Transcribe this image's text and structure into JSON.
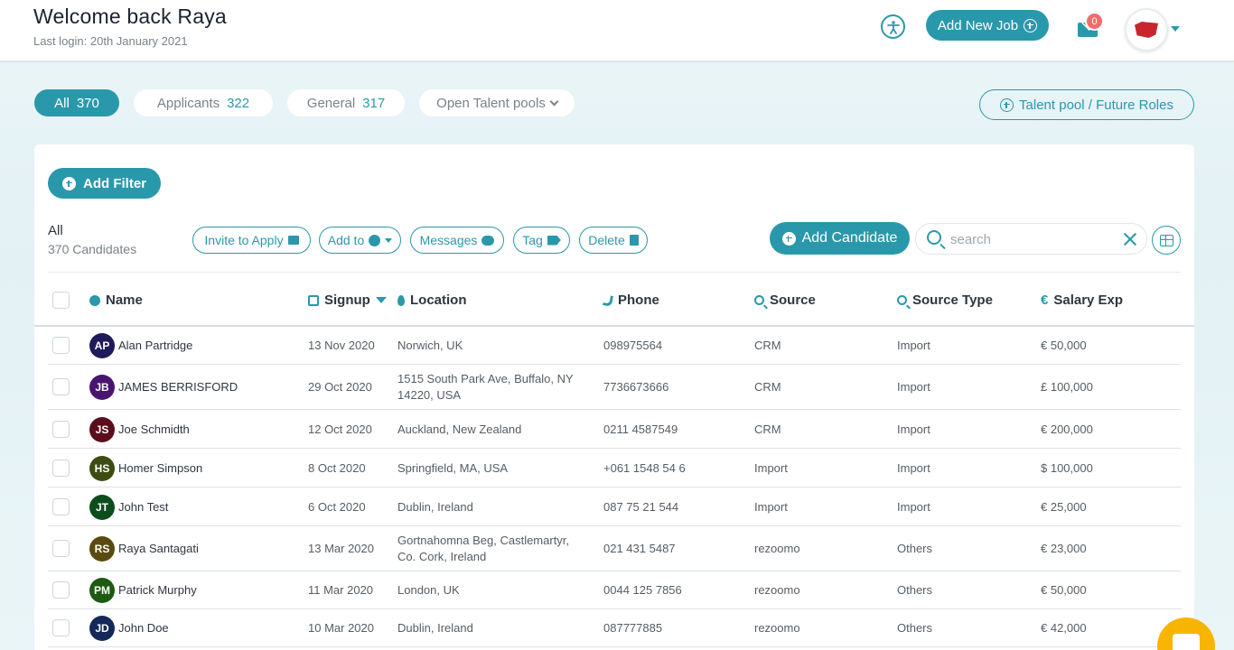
{
  "header": {
    "welcome": "Welcome back Raya",
    "last_login": "Last login: 20th January 2021",
    "add_job_label": "Add New Job",
    "mail_badge": "0"
  },
  "tabs": [
    {
      "label": "All",
      "count": "370",
      "active": true
    },
    {
      "label": "Applicants",
      "count": "322"
    },
    {
      "label": "General",
      "count": "317"
    },
    {
      "label": "Open Talent pools"
    }
  ],
  "talent_pool_label": "Talent pool / Future Roles",
  "toolbar": {
    "add_filter": "Add Filter",
    "selection_title": "All",
    "selection_count": "370 Candidates",
    "invite": "Invite to Apply",
    "add_to": "Add to",
    "messages": "Messages",
    "tag": "Tag",
    "delete": "Delete",
    "add_candidate": "Add Candidate",
    "search_placeholder": "search"
  },
  "columns": {
    "name": "Name",
    "signup": "Signup",
    "location": "Location",
    "phone": "Phone",
    "source": "Source",
    "source_type": "Source Type",
    "salary": "Salary Exp"
  },
  "rows": [
    {
      "initials": "AP",
      "color": "#1f1a5c",
      "name": "Alan Partridge",
      "signup": "13 Nov 2020",
      "location": "Norwich, UK",
      "phone": "098975564",
      "source": "CRM",
      "source_type": "Import",
      "salary": "€ 50,000"
    },
    {
      "initials": "JB",
      "color": "#4a1570",
      "name": "JAMES BERRISFORD",
      "signup": "29 Oct 2020",
      "location": "1515 South Park Ave, Buffalo, NY 14220, USA",
      "phone": "7736673666",
      "source": "CRM",
      "source_type": "Import",
      "salary": "£ 100,000"
    },
    {
      "initials": "JS",
      "color": "#5a0e1c",
      "name": "Joe Schmidth",
      "signup": "12 Oct 2020",
      "location": "Auckland, New Zealand",
      "phone": "0211 4587549",
      "source": "CRM",
      "source_type": "Import",
      "salary": "€ 200,000"
    },
    {
      "initials": "HS",
      "color": "#3d4d12",
      "name": "Homer Simpson",
      "signup": "8 Oct 2020",
      "location": "Springfield, MA, USA",
      "phone": "+061 1548 54 6",
      "source": "Import",
      "source_type": "Import",
      "salary": "$ 100,000"
    },
    {
      "initials": "JT",
      "color": "#0d4d1c",
      "name": "John Test",
      "signup": "6 Oct 2020",
      "location": "Dublin, Ireland",
      "phone": "087 75 21 544",
      "source": "Import",
      "source_type": "Import",
      "salary": "€ 25,000"
    },
    {
      "initials": "RS",
      "color": "#5a4a10",
      "name": "Raya Santagati",
      "signup": "13 Mar 2020",
      "location": "Gortnahomna Beg, Castlemartyr, Co. Cork, Ireland",
      "phone": "021 431 5487",
      "source": "rezoomo",
      "source_type": "Others",
      "salary": "€ 23,000"
    },
    {
      "initials": "PM",
      "color": "#1d5a14",
      "name": "Patrick Murphy",
      "signup": "11 Mar 2020",
      "location": "London, UK",
      "phone": "0044 125 7856",
      "source": "rezoomo",
      "source_type": "Others",
      "salary": "€ 50,000"
    },
    {
      "initials": "JD",
      "color": "#14295a",
      "name": "John Doe",
      "signup": "10 Mar 2020",
      "location": "Dublin, Ireland",
      "phone": "087777885",
      "source": "rezoomo",
      "source_type": "Others",
      "salary": "€ 42,000"
    }
  ]
}
